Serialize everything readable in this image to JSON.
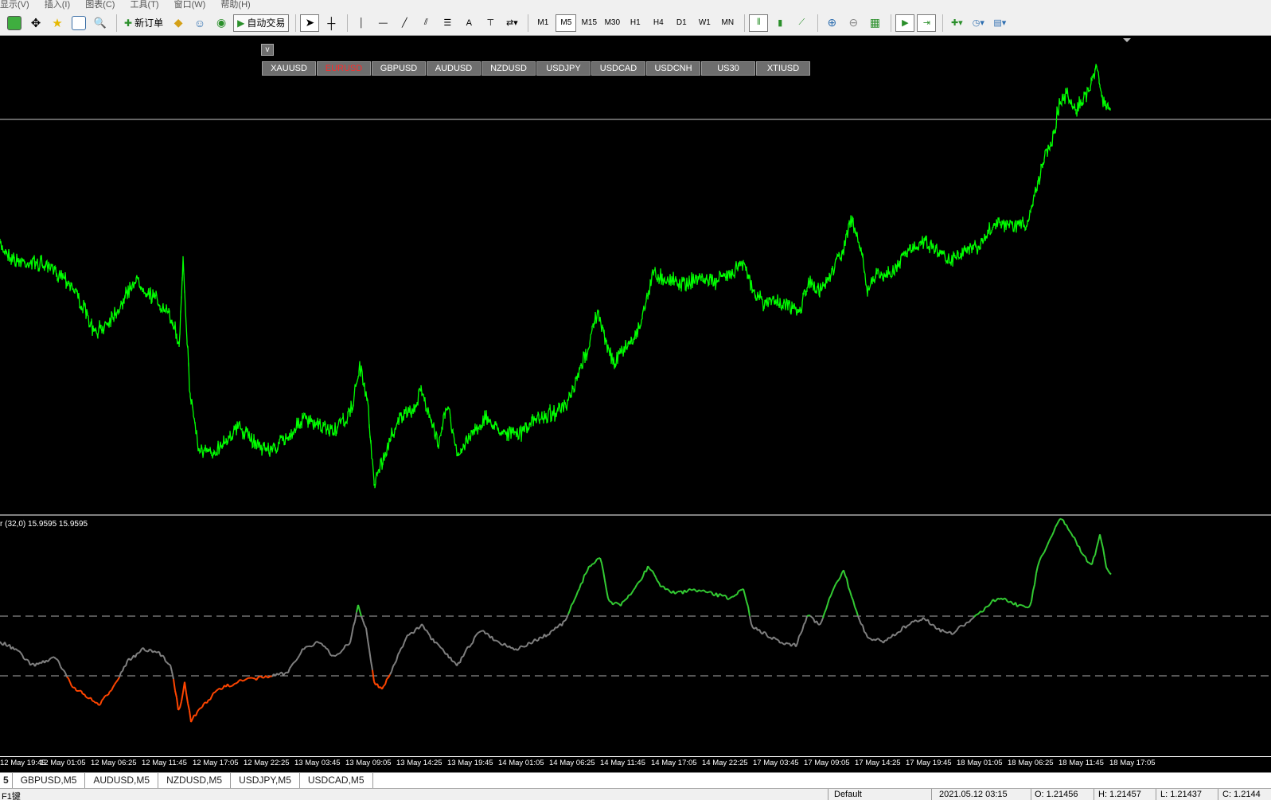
{
  "menu": [
    "显示(V)",
    "插入(I)",
    "图表(C)",
    "工具(T)",
    "窗口(W)",
    "帮助(H)"
  ],
  "toolbar": {
    "new_order": "新订单",
    "auto_trading": "自动交易",
    "line_text_tool": "A",
    "timeframes": [
      "M1",
      "M5",
      "M15",
      "M30",
      "H1",
      "H4",
      "D1",
      "W1",
      "MN"
    ],
    "active_timeframe": "M5"
  },
  "chart": {
    "collapse_button": "v",
    "symbols": [
      "XAUUSD",
      "EURUSD",
      "GBPUSD",
      "AUDUSD",
      "NZDUSD",
      "USDJPY",
      "USDCAD",
      "USDCNH",
      "US30",
      "XTIUSD"
    ],
    "active_symbol": "EURUSD",
    "price_color": "#00ff00",
    "indicator_up_color": "#33cc33",
    "indicator_neutral_color": "#808080",
    "indicator_down_color": "#ff4500",
    "indicator_label": "r (32,0) 15.9595 15.9595"
  },
  "time_axis": [
    "12 May 19:45",
    "12 May 01:05",
    "12 May 06:25",
    "12 May 11:45",
    "12 May 17:05",
    "12 May 22:25",
    "13 May 03:45",
    "13 May 09:05",
    "13 May 14:25",
    "13 May 19:45",
    "14 May 01:05",
    "14 May 06:25",
    "14 May 11:45",
    "14 May 17:05",
    "14 May 22:25",
    "17 May 03:45",
    "17 May 09:05",
    "17 May 14:25",
    "17 May 19:45",
    "18 May 01:05",
    "18 May 06:25",
    "18 May 11:45",
    "18 May 17:05"
  ],
  "tabs": [
    "5",
    "GBPUSD,M5",
    "AUDUSD,M5",
    "NZDUSD,M5",
    "USDJPY,M5",
    "USDCAD,M5"
  ],
  "status": {
    "help": "F1键",
    "profile": "Default",
    "datetime": "2021.05.12 03:15",
    "open": "O: 1.21456",
    "high": "H: 1.21457",
    "low": "L: 1.21437",
    "close": "C: 1.2144"
  }
}
